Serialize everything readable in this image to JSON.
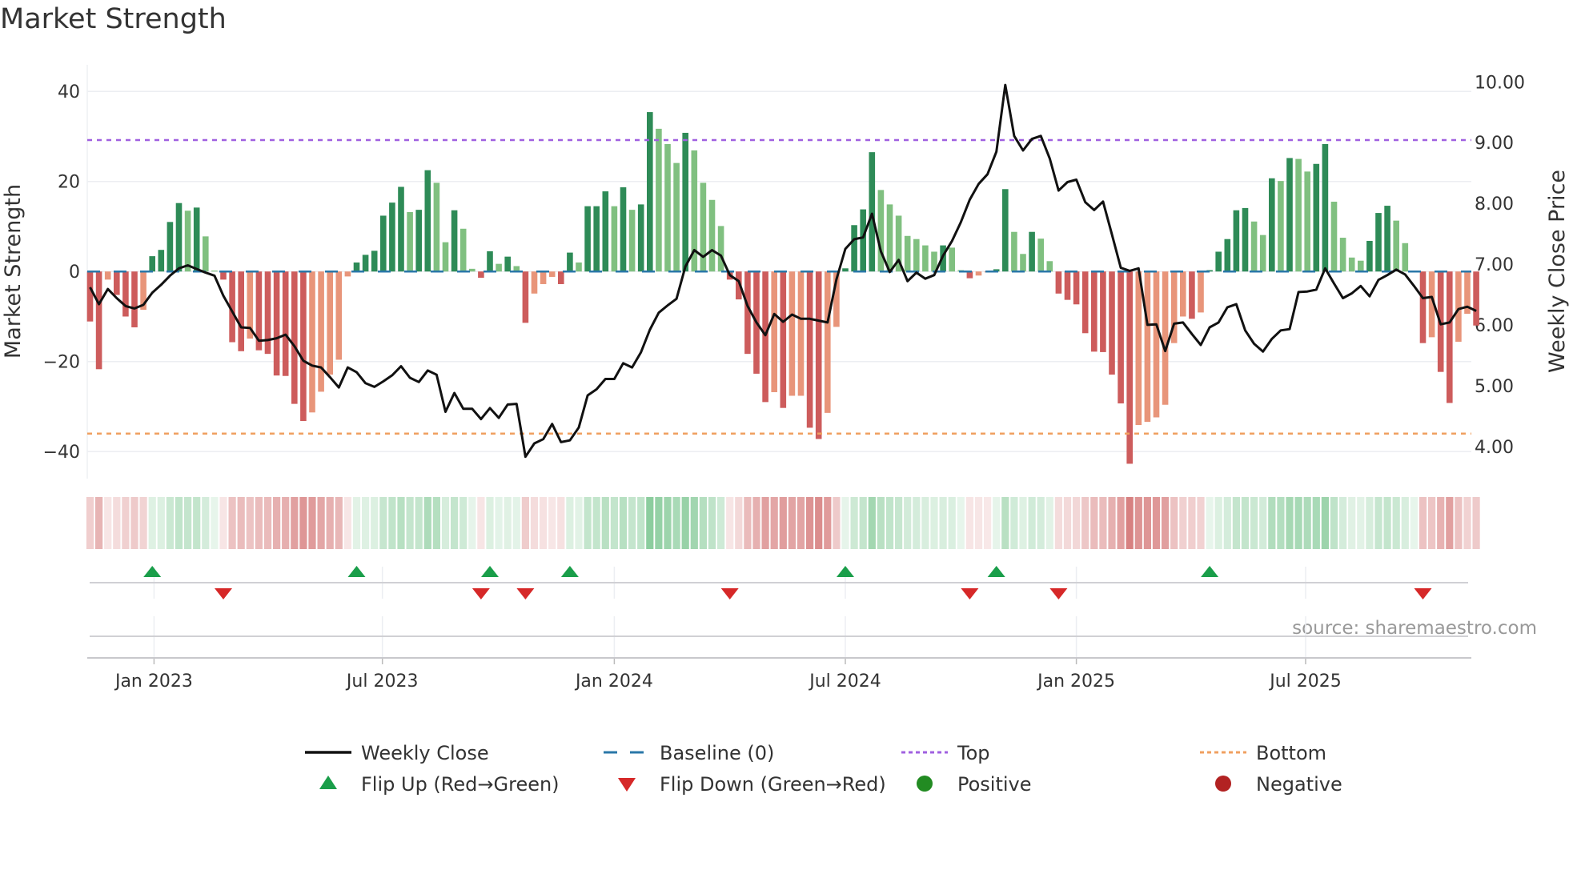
{
  "title": "Market Strength",
  "source": "source: sharemaestro.com",
  "colors": {
    "rise_pos": "#2e8b57",
    "fall_pos": "#80c080",
    "fall_neg": "#cd5c5c",
    "rise_neg": "#e8957a",
    "baseline": "#2a77a8",
    "top": "#a060e0",
    "bottom": "#f0a060",
    "flip_up": "#1a9e4a",
    "flip_down": "#d62828",
    "positive": "#228b22",
    "negative": "#b22222",
    "price": "#111111"
  },
  "chart_data": {
    "type": "bar",
    "title": "Market Strength",
    "ylabel": "Market Strength",
    "y2label": "Weekly Close Price",
    "ylim": [
      -46,
      45.9
    ],
    "y2lim": [
      3.47,
      10.28
    ],
    "yticks": [
      40,
      20,
      0,
      -20,
      -40
    ],
    "ytick_labels": [
      "40",
      "20",
      "0",
      "−20",
      "−40"
    ],
    "y2ticks": [
      10,
      9,
      8,
      7,
      6,
      5,
      4
    ],
    "y2tick_labels": [
      "10.00",
      "9.00",
      "8.00",
      "7.00",
      "6.00",
      "5.00",
      "4.00"
    ],
    "x_unit": "week index",
    "xticks": [
      {
        "week": 7.2,
        "label": "Jan 2023"
      },
      {
        "week": 32.9,
        "label": "Jul 2023"
      },
      {
        "week": 59.0,
        "label": "Jan 2024"
      },
      {
        "week": 85.0,
        "label": "Jul 2024"
      },
      {
        "week": 111.0,
        "label": "Jan 2025"
      },
      {
        "week": 136.8,
        "label": "Jul 2025"
      }
    ],
    "top_level": 29.2,
    "bottom_level": -36,
    "grid": true,
    "legend_position": "bottom",
    "strength": [
      -11.1,
      -21.7,
      -1.8,
      -5.2,
      -10,
      -12.4,
      -8.5,
      3.4,
      4.8,
      11,
      15.2,
      13.5,
      14.2,
      7.8,
      0.2,
      -1.8,
      -15.7,
      -17.7,
      -14.9,
      -17.5,
      -18.3,
      -23.1,
      -23.2,
      -29.4,
      -33.2,
      -31.3,
      -26.7,
      -22.9,
      -19.6,
      -1.1,
      2,
      3.7,
      4.6,
      12.4,
      15.3,
      18.8,
      13.2,
      13.7,
      22.5,
      19.7,
      6.5,
      13.6,
      9.5,
      0.6,
      -1.4,
      4.5,
      1.7,
      3.3,
      1.2,
      -11.4,
      -4.9,
      -2.8,
      -1.2,
      -2.8,
      4.2,
      2,
      14.5,
      14.5,
      17.8,
      14.5,
      18.7,
      13.7,
      14.9,
      35.4,
      31.7,
      28.3,
      24.1,
      30.8,
      26.9,
      19.7,
      15.9,
      10.1,
      -1.8,
      -6.2,
      -18.3,
      -22.7,
      -29,
      -26.8,
      -30.3,
      -27.6,
      -27.6,
      -34.7,
      -37.2,
      -31.4,
      -12.3,
      0.7,
      10.3,
      13.8,
      26.5,
      18.1,
      14.9,
      12.4,
      7.9,
      7.2,
      5.8,
      4.4,
      5.8,
      5.3,
      0.3,
      -1.5,
      -0.9,
      -0.2,
      0.5,
      18.3,
      8.8,
      3.9,
      8.8,
      7.3,
      2.3,
      -4.9,
      -6.3,
      -7.3,
      -13.7,
      -17.8,
      -17.9,
      -22.9,
      -29.3,
      -42.7,
      -34.1,
      -33.4,
      -32.4,
      -29.6,
      -15.9,
      -10,
      -10.5,
      -9.1,
      0.3,
      4.4,
      7.2,
      13.6,
      14.1,
      11.1,
      8.1,
      20.7,
      20.1,
      25.2,
      25,
      22.2,
      23.9,
      28.3,
      15.5,
      7.5,
      3.1,
      2.4,
      6.8,
      13,
      14.6,
      11.3,
      6.3,
      0.1,
      -15.9,
      -14.6,
      -22.3,
      -29.2,
      -15.6,
      -9.4,
      -12
    ],
    "weekly_close": [
      6.62,
      6.34,
      6.59,
      6.44,
      6.31,
      6.27,
      6.33,
      6.53,
      6.66,
      6.81,
      6.93,
      6.98,
      6.92,
      6.86,
      6.81,
      6.48,
      6.22,
      5.96,
      5.95,
      5.74,
      5.75,
      5.78,
      5.84,
      5.65,
      5.41,
      5.33,
      5.3,
      5.14,
      4.97,
      5.3,
      5.22,
      5.04,
      4.98,
      5.07,
      5.17,
      5.32,
      5.13,
      5.06,
      5.25,
      5.18,
      4.57,
      4.88,
      4.62,
      4.62,
      4.45,
      4.63,
      4.47,
      4.69,
      4.7,
      3.83,
      4.05,
      4.12,
      4.37,
      4.07,
      4.1,
      4.31,
      4.84,
      4.94,
      5.11,
      5.11,
      5.37,
      5.3,
      5.55,
      5.92,
      6.2,
      6.32,
      6.43,
      6.96,
      7.23,
      7.12,
      7.23,
      7.14,
      6.82,
      6.72,
      6.31,
      6.04,
      5.83,
      6.18,
      6.05,
      6.17,
      6.1,
      6.1,
      6.07,
      6.04,
      6.75,
      7.25,
      7.41,
      7.44,
      7.83,
      7.21,
      6.87,
      7.07,
      6.72,
      6.86,
      6.76,
      6.82,
      7.14,
      7.38,
      7.69,
      8.06,
      8.32,
      8.48,
      8.85,
      9.95,
      9.11,
      8.87,
      9.06,
      9.11,
      8.74,
      8.21,
      8.35,
      8.39,
      8.02,
      7.89,
      8.03,
      7.49,
      6.94,
      6.89,
      6.93,
      6.0,
      6.01,
      5.57,
      6.02,
      6.04,
      5.85,
      5.67,
      5.96,
      6.04,
      6.29,
      6.34,
      5.91,
      5.69,
      5.56,
      5.77,
      5.91,
      5.93,
      6.54,
      6.55,
      6.58,
      6.93,
      6.68,
      6.44,
      6.52,
      6.64,
      6.47,
      6.74,
      6.82,
      6.91,
      6.83,
      6.64,
      6.44,
      6.46,
      6.01,
      6.04,
      6.26,
      6.3,
      6.23
    ],
    "legend": [
      {
        "key": "close",
        "label": "Weekly Close"
      },
      {
        "key": "baseline",
        "label": "Baseline (0)"
      },
      {
        "key": "top",
        "label": "Top"
      },
      {
        "key": "bottom",
        "label": "Bottom"
      },
      {
        "key": "flip_up",
        "label": "Flip Up (Red→Green)"
      },
      {
        "key": "flip_down",
        "label": "Flip Down (Green→Red)"
      },
      {
        "key": "positive",
        "label": "Positive"
      },
      {
        "key": "negative",
        "label": "Negative"
      }
    ]
  }
}
